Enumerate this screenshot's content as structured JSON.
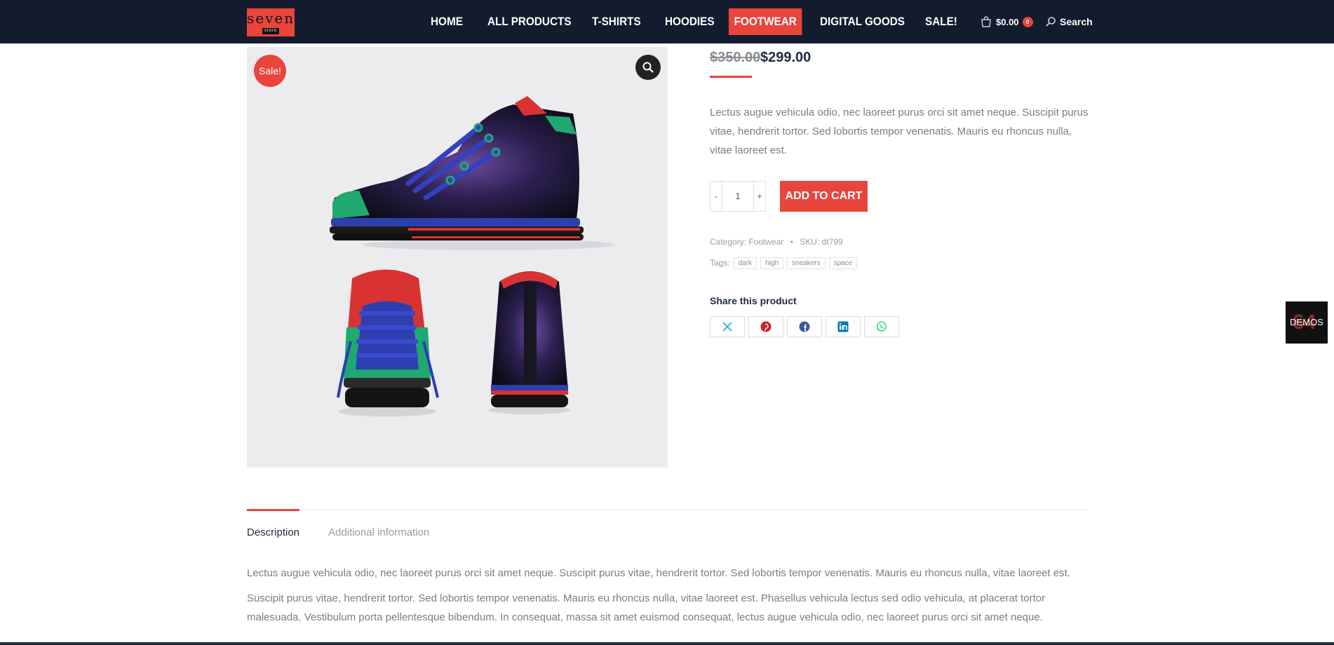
{
  "header": {
    "logo_top": "seven",
    "logo_bottom": "store",
    "nav": [
      {
        "label": "HOME"
      },
      {
        "label": "ALL PRODUCTS"
      },
      {
        "label": "T-SHIRTS"
      },
      {
        "label": "HOODIES"
      },
      {
        "label": "FOOTWEAR",
        "active": true
      },
      {
        "label": "DIGITAL GOODS"
      },
      {
        "label": "SALE!"
      }
    ],
    "cart_total": "$0.00",
    "cart_count": "0",
    "search_label": "Search"
  },
  "product": {
    "sale_badge": "Sale!",
    "price_old": "$350.00",
    "price_new": "$299.00",
    "short_description": "Lectus augue vehicula odio, nec laoreet purus orci sit amet neque. Suscipit purus vitae, hendrerit tortor. Sed lobortis tempor venenatis. Mauris eu rhoncus nulla, vitae laoreet est.",
    "quantity": "1",
    "qty_minus": "-",
    "qty_plus": "+",
    "add_to_cart": "ADD TO CART",
    "category_label": "Category:",
    "category_value": "Footwear",
    "separator": "•",
    "sku_label": "SKU:",
    "sku_value": "dt799",
    "tags_label": "Tags:",
    "tags": [
      "dark",
      "high",
      "sneakers",
      "space"
    ],
    "share_title": "Share this product",
    "share_buttons": [
      {
        "icon": "x-twitter-icon",
        "color": "#27a9e1"
      },
      {
        "icon": "pinterest-icon",
        "color": "#c8232c"
      },
      {
        "icon": "facebook-icon",
        "color": "#3b5998"
      },
      {
        "icon": "linkedin-icon",
        "color": "#0077b5"
      },
      {
        "icon": "whatsapp-icon",
        "color": "#25d366"
      }
    ]
  },
  "demos_label": "DEMOS",
  "demos_count": "64",
  "tabs": [
    {
      "label": "Description",
      "active": true
    },
    {
      "label": "Additional information"
    }
  ],
  "description": {
    "p1": "Lectus augue vehicula odio, nec laoreet purus orci sit amet neque. Suscipit purus vitae, hendrerit tortor. Sed lobortis tempor venenatis. Mauris eu rhoncus nulla, vitae laoreet est.",
    "p2": "Suscipit purus vitae, hendrerit tortor. Sed lobortis tempor venenatis. Mauris eu rhoncus nulla, vitae laoreet est. Phasellus vehicula lectus sed odio vehicula, at placerat tortor malesuada. Vestibulum porta pellentesque bibendum. In consequat, massa sit amet euismod consequat, lectus augue vehicula odio, nec laoreet purus orci sit amet neque."
  },
  "colors": {
    "accent": "#e8453c",
    "header_bg": "#121c2e"
  }
}
